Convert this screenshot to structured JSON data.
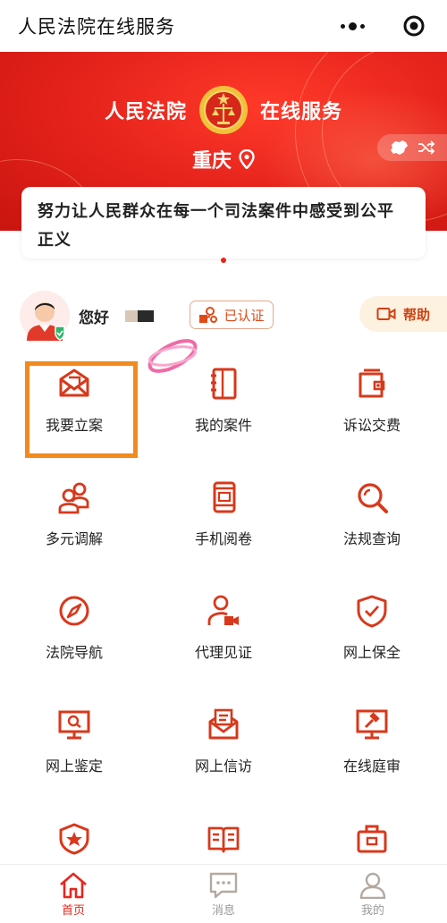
{
  "app": {
    "title": "人民法院在线服务"
  },
  "banner": {
    "brand_left": "人民法院",
    "brand_right": "在线服务",
    "city": "重庆",
    "motto": "努力让人民群众在每一个司法案件中感受到公平正义"
  },
  "user": {
    "greeting": "您好",
    "verified_label": "已认证",
    "help_label": "帮助"
  },
  "services": [
    {
      "label": "我要立案",
      "icon": "envelope-icon"
    },
    {
      "label": "我的案件",
      "icon": "notebook-icon"
    },
    {
      "label": "诉讼交费",
      "icon": "wallet-icon"
    },
    {
      "label": "多元调解",
      "icon": "people-icon"
    },
    {
      "label": "手机阅卷",
      "icon": "phone-icon"
    },
    {
      "label": "法规查询",
      "icon": "search-icon"
    },
    {
      "label": "法院导航",
      "icon": "compass-icon"
    },
    {
      "label": "代理见证",
      "icon": "video-person-icon"
    },
    {
      "label": "网上保全",
      "icon": "shield-check-icon"
    },
    {
      "label": "网上鉴定",
      "icon": "monitor-search-icon"
    },
    {
      "label": "网上信访",
      "icon": "letter-icon"
    },
    {
      "label": "在线庭审",
      "icon": "gavel-screen-icon"
    },
    {
      "label": "",
      "icon": "star-badge-icon"
    },
    {
      "label": "",
      "icon": "book-icon"
    },
    {
      "label": "",
      "icon": "briefcase-icon"
    }
  ],
  "tabbar": {
    "items": [
      {
        "label": "首页",
        "icon": "home-icon",
        "active": true
      },
      {
        "label": "消息",
        "icon": "message-icon",
        "active": false
      },
      {
        "label": "我的",
        "icon": "person-icon",
        "active": false
      }
    ]
  },
  "colors": {
    "primary": "#e8251d",
    "icon": "#d8381b",
    "highlight": "#f08a1e",
    "help_bg": "#fdf1e0"
  }
}
